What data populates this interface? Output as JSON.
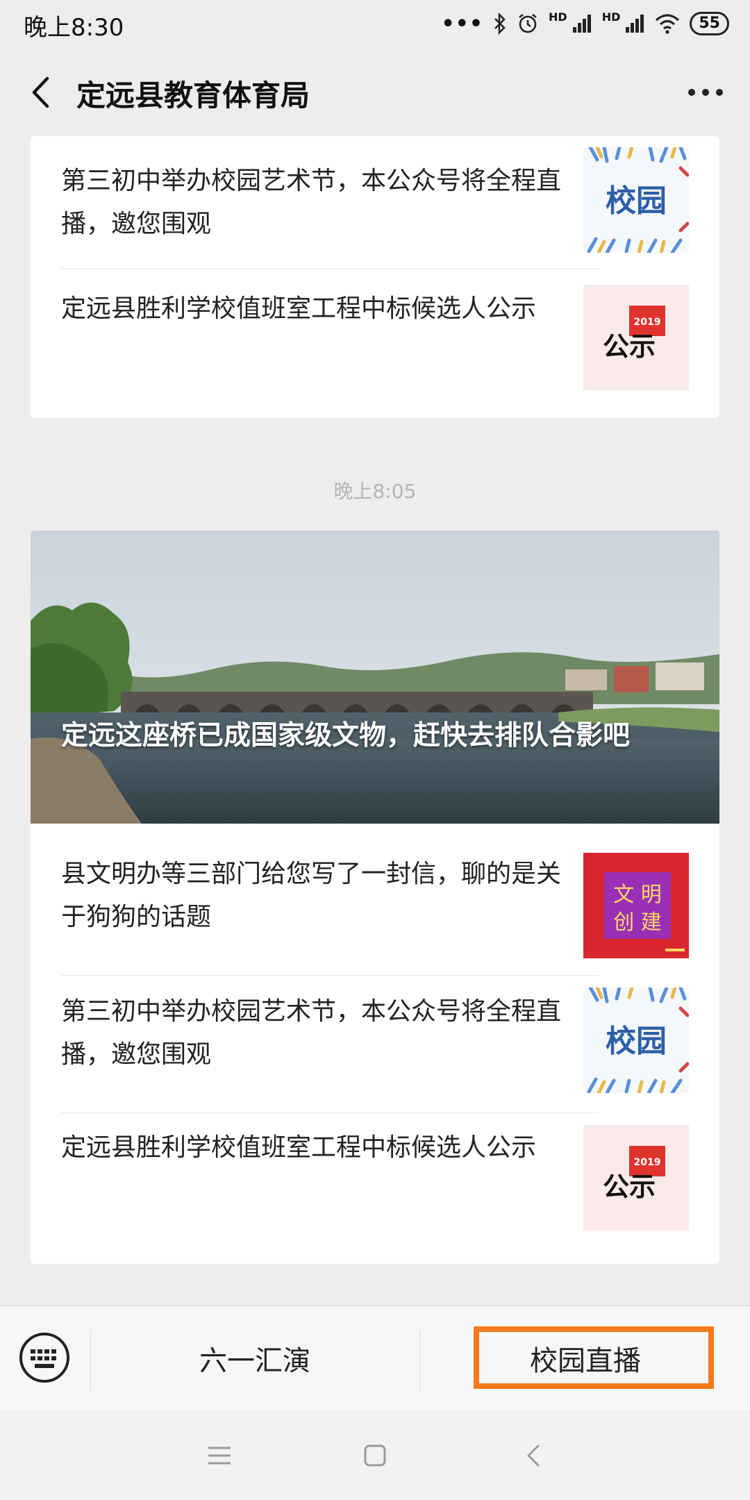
{
  "status_bar": {
    "time": "晚上8:30",
    "dots": "•••",
    "hd1": "HD",
    "hd2": "HD",
    "battery": "55"
  },
  "header": {
    "title": "定远县教育体育局",
    "back_icon": "chevron-left-icon",
    "more_icon": "more-dots-icon"
  },
  "group1": {
    "articles": [
      {
        "title": "第三初中举办校园艺术节，本公众号将全程直播，邀您围观",
        "thumb_text": "校园"
      },
      {
        "title": "定远县胜利学校值班室工程中标候选人公示",
        "thumb_text": "公示",
        "thumb_year": "2019"
      }
    ]
  },
  "timestamp": "晚上8:05",
  "group2": {
    "hero_title": "定远这座桥已成国家级文物，赶快去排队合影吧",
    "articles": [
      {
        "title": "县文明办等三部门给您写了一封信，聊的是关于狗狗的话题",
        "thumb_line1": "文 明",
        "thumb_line2": "创 建"
      },
      {
        "title": "第三初中举办校园艺术节，本公众号将全程直播，邀您围观",
        "thumb_text": "校园"
      },
      {
        "title": "定远县胜利学校值班室工程中标候选人公示",
        "thumb_text": "公示",
        "thumb_year": "2019"
      }
    ]
  },
  "menu": {
    "items": [
      "六一汇演",
      "校园直播"
    ],
    "highlight_color": "#f57a1c",
    "keyboard_icon": "keyboard-icon"
  },
  "nav": {
    "icons": [
      "menu-icon",
      "home-square-icon",
      "back-arrow-icon"
    ]
  }
}
